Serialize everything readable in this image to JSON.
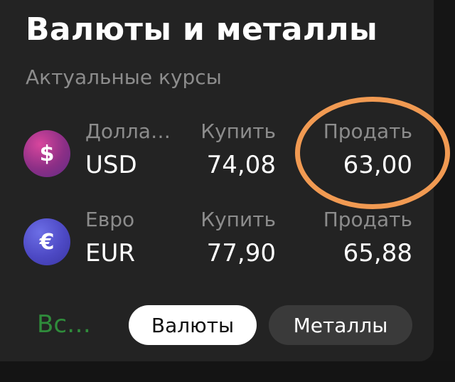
{
  "header": {
    "title": "Валюты и металлы",
    "subtitle": "Актуальные курсы"
  },
  "rates": [
    {
      "icon": "dollar-sign-icon",
      "icon_glyph": "$",
      "name": "Долла…",
      "code": "USD",
      "buy_label": "Купить",
      "buy_value": "74,08",
      "sell_label": "Продать",
      "sell_value": "63,00",
      "badge_color": "#a0328f"
    },
    {
      "icon": "euro-sign-icon",
      "icon_glyph": "€",
      "name": "Евро",
      "code": "EUR",
      "buy_label": "Купить",
      "buy_value": "77,90",
      "sell_label": "Продать",
      "sell_value": "65,88",
      "badge_color": "#4d49c4"
    }
  ],
  "footer": {
    "all_link": "Вс…",
    "tabs": [
      {
        "label": "Валюты",
        "active": true
      },
      {
        "label": "Металлы",
        "active": false
      }
    ]
  },
  "colors": {
    "background": "#232323",
    "link_green": "#2f8c3b",
    "annotation_orange": "#f19a52"
  }
}
